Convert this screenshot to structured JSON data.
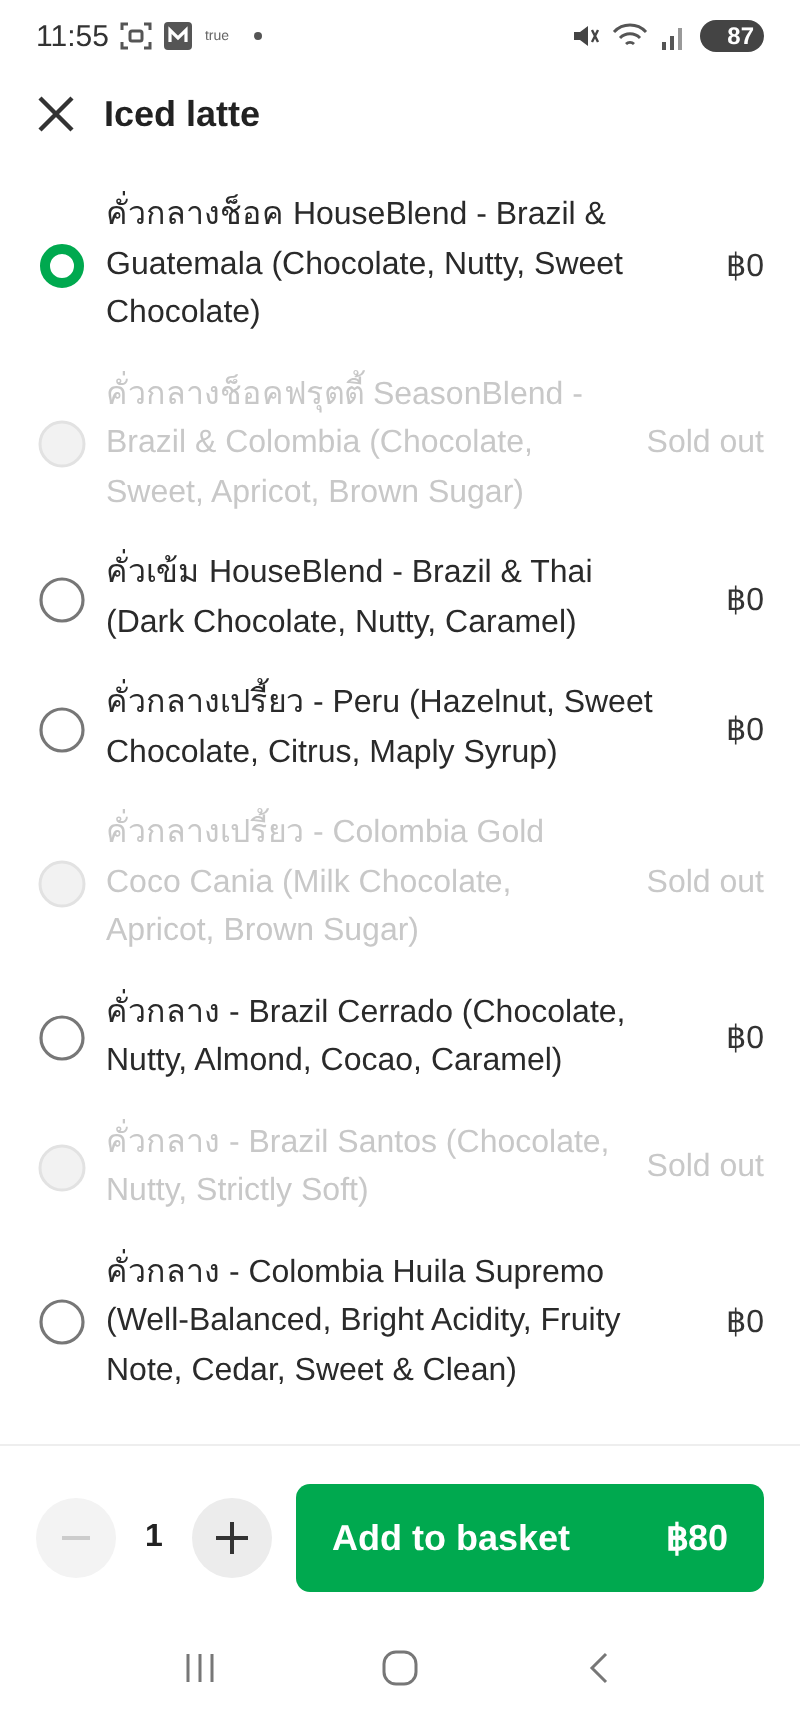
{
  "status_bar": {
    "time": "11:55",
    "carrier": "true",
    "battery": "87"
  },
  "header": {
    "title": "Iced latte"
  },
  "options": [
    {
      "label": "คั่วกลางช็อค HouseBlend - Brazil & Guatemala (Chocolate, Nutty, Sweet Chocolate)",
      "trailing": "฿0",
      "selected": true,
      "disabled": false
    },
    {
      "label": "คั่วกลางช็อคฟรุตตี้ SeasonBlend - Brazil & Colombia (Chocolate, Sweet, Apricot, Brown Sugar)",
      "trailing": "Sold out",
      "selected": false,
      "disabled": true
    },
    {
      "label": "คั่วเข้ม HouseBlend - Brazil & Thai (Dark Chocolate, Nutty, Caramel)",
      "trailing": "฿0",
      "selected": false,
      "disabled": false
    },
    {
      "label": "คั่วกลางเปรี้ยว - Peru (Hazelnut, Sweet Chocolate, Citrus, Maply Syrup)",
      "trailing": "฿0",
      "selected": false,
      "disabled": false
    },
    {
      "label": "คั่วกลางเปรี้ยว - Colombia  Gold Coco Cania (Milk Chocolate, Apricot, Brown Sugar)",
      "trailing": "Sold out",
      "selected": false,
      "disabled": true
    },
    {
      "label": "คั่วกลาง - Brazil Cerrado (Chocolate, Nutty, Almond, Cocao, Caramel)",
      "trailing": "฿0",
      "selected": false,
      "disabled": false
    },
    {
      "label": "คั่วกลาง - Brazil Santos (Chocolate, Nutty, Strictly Soft)",
      "trailing": "Sold out",
      "selected": false,
      "disabled": true
    },
    {
      "label": "คั่วกลาง - Colombia Huila Supremo (Well-Balanced, Bright Acidity, Fruity Note, Cedar, Sweet & Clean)",
      "trailing": "฿0",
      "selected": false,
      "disabled": false
    }
  ],
  "footer": {
    "minus_disabled": true,
    "plus_disabled": false,
    "quantity": "1",
    "button": {
      "label": "Add to basket",
      "price": "฿80"
    }
  }
}
